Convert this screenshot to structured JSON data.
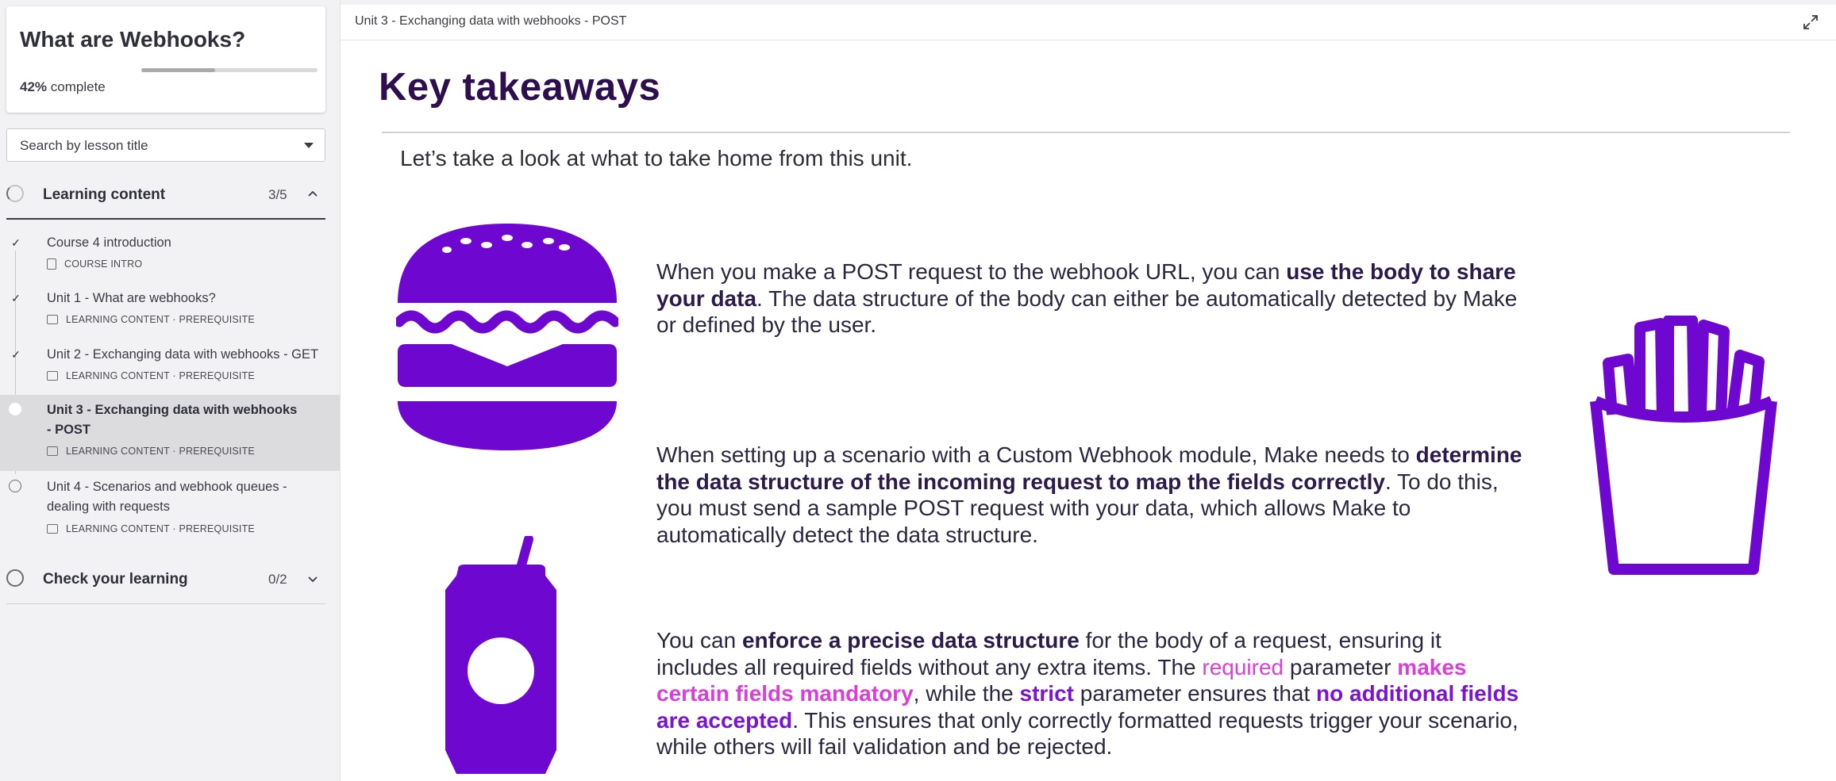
{
  "course": {
    "title": "What are Webhooks?",
    "progress_pct": "42%",
    "progress_suffix": "complete",
    "progress_fraction": 0.42
  },
  "search": {
    "placeholder": "Search by lesson title"
  },
  "sections": [
    {
      "title": "Learning content",
      "count": "3/5"
    },
    {
      "title": "Check your learning",
      "count": "0/2"
    }
  ],
  "lessons": [
    {
      "title": "Course 4 introduction",
      "meta": "COURSE INTRO",
      "status": "done"
    },
    {
      "title": "Unit 1 - What are webhooks?",
      "meta": "LEARNING CONTENT · PREREQUISITE",
      "status": "done"
    },
    {
      "title": "Unit 2 - Exchanging data with webhooks - GET",
      "meta": "LEARNING CONTENT · PREREQUISITE",
      "status": "done"
    },
    {
      "title": "Unit 3 - Exchanging data with webhooks - POST",
      "meta": "LEARNING CONTENT · PREREQUISITE",
      "status": "current"
    },
    {
      "title": "Unit 4 - Scenarios and webhook queues - dealing with requests",
      "meta": "LEARNING CONTENT · PREREQUISITE",
      "status": "todo"
    }
  ],
  "main": {
    "breadcrumb": "Unit 3 - Exchanging data with webhooks - POST",
    "heading": "Key takeaways",
    "intro": "Let’s take a look at what to take home from this unit.",
    "p1": {
      "a": "When you make a POST request to the webhook URL, you can ",
      "b": "use the body to share your data",
      "c": ". The data structure of the body can either be automatically detected by Make or defined by the user."
    },
    "p2": {
      "a": "When setting up a scenario with a Custom Webhook module, Make needs to ",
      "b": "determine the data structure of the incoming request to map the fields correctly",
      "c": ". To do this, you must send a sample POST request with your data, which allows Make to automatically detect the data structure."
    },
    "p3": {
      "a": "You can ",
      "b": "enforce a precise data structure",
      "c": " for the body of a request, ensuring it includes all required fields without any extra items. The ",
      "d": "required",
      "e": " parameter ",
      "f": "makes certain fields mandatory",
      "g": ", while the ",
      "h": "strict",
      "i": " parameter ensures that ",
      "j": "no additional fields are accepted",
      "k": ". This ensures that only correctly formatted requests trigger your scenario, while others will fail validation and be rejected."
    }
  },
  "colors": {
    "illustration": "#6e08d0",
    "heading": "#2d0f4d",
    "pink_highlight": "#d93ed9",
    "purple_highlight": "#7a14d1"
  },
  "icons": [
    "expand-icon",
    "chevron-up-icon",
    "chevron-down-icon",
    "check-icon",
    "document-icon",
    "slides-icon",
    "burger-illustration",
    "soda-can-illustration",
    "fries-illustration"
  ]
}
